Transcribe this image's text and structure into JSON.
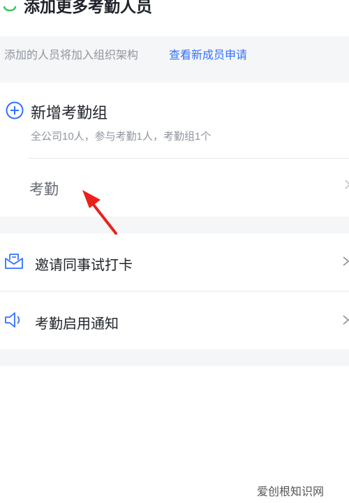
{
  "top": {
    "label": "添加更多考勤人员"
  },
  "hint": {
    "text": "添加的人员将加入组织架构",
    "link": "查看新成员申请"
  },
  "group": {
    "title": "新增考勤组",
    "subtitle": "全公司10人，参与考勤1人，考勤组1个",
    "row_label": "考勤"
  },
  "menu": {
    "invite_label": "邀请同事试打卡",
    "notify_label": "考勤启用通知"
  },
  "watermark": "爱创根知识网",
  "colors": {
    "accent": "#3370ff",
    "annotation_arrow": "#e8221b",
    "top_icon": "#34c759"
  },
  "icons": {
    "top": "green-ring-icon",
    "add": "plus-circle-icon",
    "invite": "envelope-icon",
    "notify": "speaker-icon",
    "chevron": "chevron-right-icon"
  }
}
